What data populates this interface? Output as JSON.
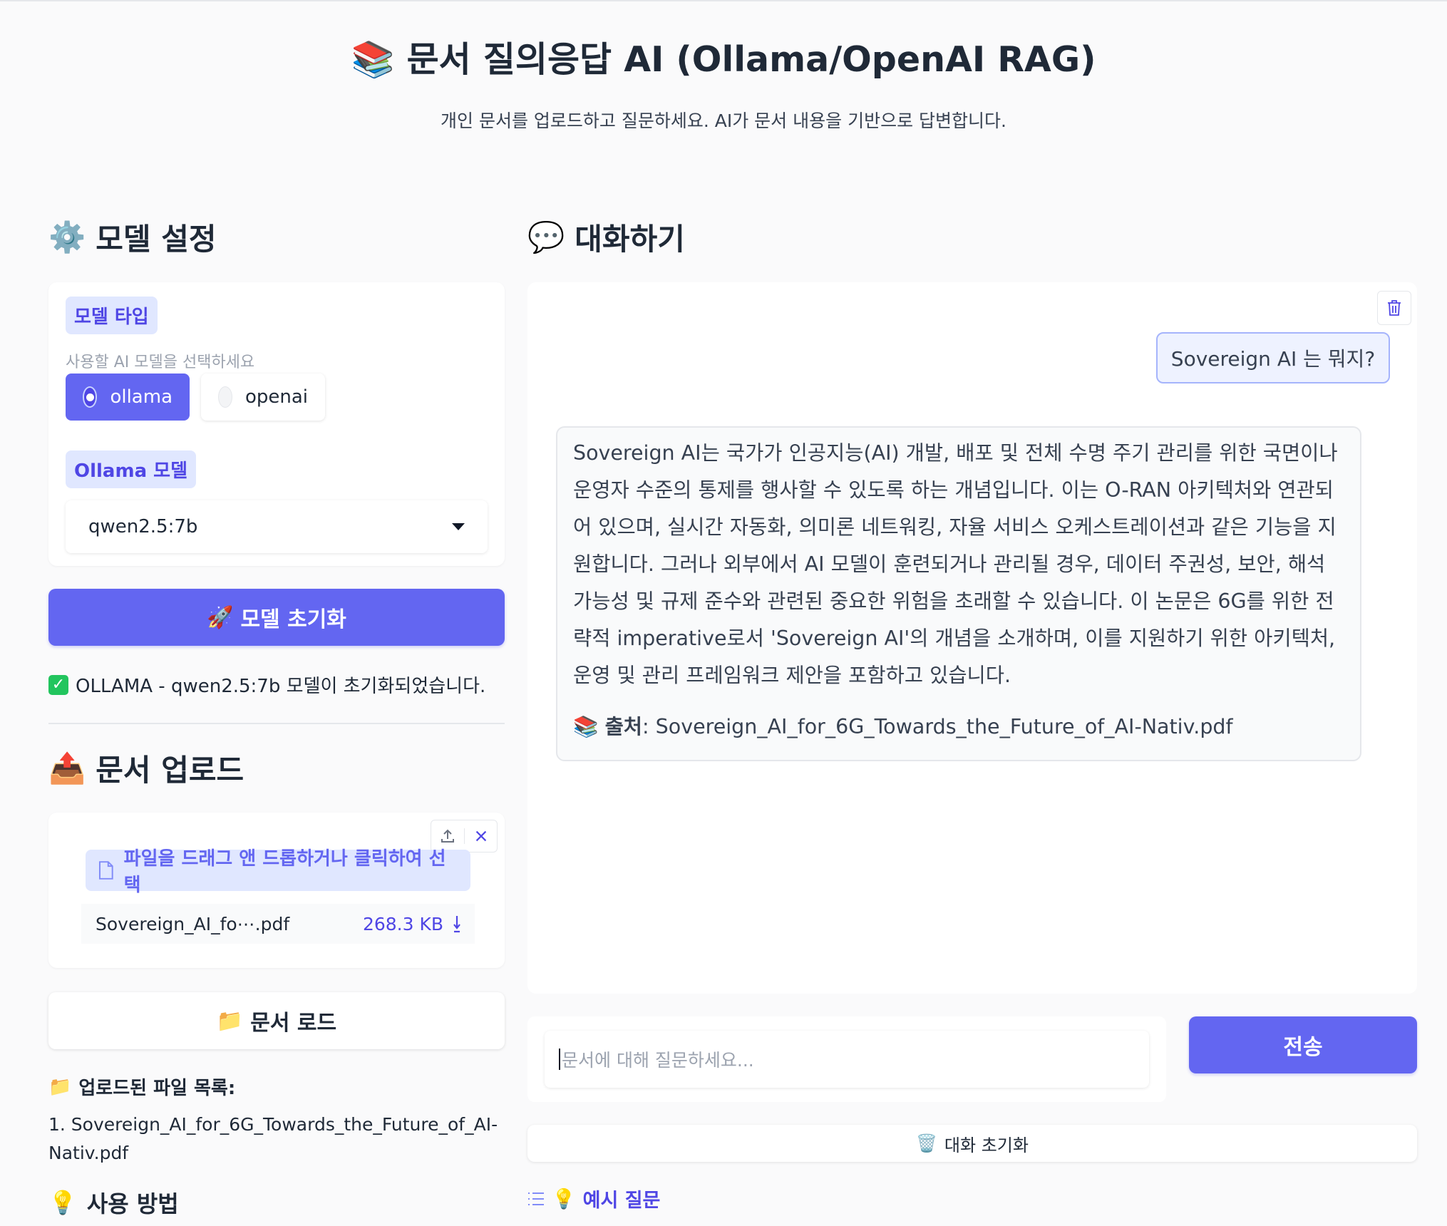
{
  "header": {
    "title_icon": "📚",
    "title": "문서 질의응답 AI (Ollama/OpenAI RAG)",
    "subtitle": "개인 문서를 업로드하고 질문하세요. AI가 문서 내용을 기반으로 답변합니다."
  },
  "settings": {
    "heading_icon": "⚙️",
    "heading": "모델 설정",
    "model_type_label": "모델 타입",
    "model_type_info": "사용할 AI 모델을 선택하세요",
    "options": [
      {
        "label": "ollama",
        "selected": true
      },
      {
        "label": "openai",
        "selected": false
      }
    ],
    "ollama_model_label": "Ollama 모델",
    "ollama_model_value": "qwen2.5:7b",
    "init_button_icon": "🚀",
    "init_button": "모델 초기화",
    "status_icon": "✓",
    "status_text": "OLLAMA - qwen2.5:7b 모델이 초기화되었습니다."
  },
  "upload": {
    "heading_icon": "📤",
    "heading": "문서 업로드",
    "drop_label": "파일을 드래그 앤 드롭하거나 클릭하여 선택",
    "file_name": "Sovereign_AI_fo⋯.pdf",
    "file_size": "268.3 KB",
    "load_button_icon": "📁",
    "load_button": "문서 로드",
    "list_icon": "📁",
    "list_title": "업로드된 파일 목록:",
    "list_items": [
      "1. Sovereign_AI_for_6G_Towards_the_Future_of_AI-",
      "Nativ.pdf"
    ],
    "howto_icon": "💡",
    "howto_heading": "사용 방법"
  },
  "chat": {
    "heading_icon": "💬",
    "heading": "대화하기",
    "user_message": "Sovereign AI 는 뭐지?",
    "bot_message": "Sovereign AI는 국가가 인공지능(AI) 개발, 배포 및 전체 수명 주기 관리를 위한 국면이나 운영자 수준의 통제를 행사할 수 있도록 하는 개념입니다. 이는 O-RAN 아키텍처와 연관되어 있으며, 실시간 자동화, 의미론 네트워킹, 자율 서비스 오케스트레이션과 같은 기능을 지원합니다. 그러나 외부에서 AI 모델이 훈련되거나 관리될 경우, 데이터 주권성, 보안, 해석 가능성 및 규제 준수와 관련된 중요한 위험을 초래할 수 있습니다. 이 논문은 6G를 위한 전략적 imperative로서 'Sovereign AI'의 개념을 소개하며, 이를 지원하기 위한 아키텍처, 운영 및 관리 프레임워크 제안을 포함하고 있습니다.",
    "source_icon": "📚",
    "source_label": "출처",
    "source_value": ": Sovereign_AI_for_6G_Towards_the_Future_of_AI-Nativ.pdf",
    "input_placeholder": "문서에 대해 질문하세요...",
    "send_button": "전송",
    "reset_icon": "🗑️",
    "reset_button": "대화 초기화",
    "examples_icon": "💡",
    "examples_label": "예시 질문"
  },
  "colors": {
    "accent": "#6366f1",
    "accent_light": "#e0e7ff",
    "success": "#22c55e"
  }
}
